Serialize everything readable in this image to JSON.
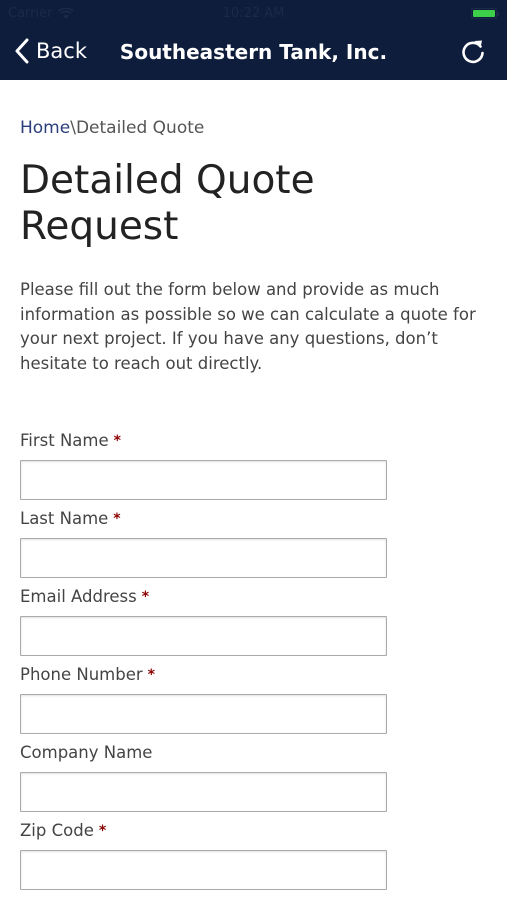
{
  "status_bar": {
    "carrier": "Carrier",
    "time": "10:22 AM"
  },
  "nav": {
    "back_label": "Back",
    "title": "Southeastern Tank, Inc.",
    "back_icon": "chevron-left-icon",
    "refresh_icon": "refresh-icon"
  },
  "breadcrumb": {
    "home": "Home",
    "separator": "\\",
    "current": "Detailed Quote"
  },
  "page": {
    "heading_line1": "Detailed Quote",
    "heading_line2": "Request",
    "intro": "Please fill out the form below and provide as much information as possible so we can calculate a quote for your next project. If you have any questions, don’t hesitate to reach out directly."
  },
  "form": {
    "first_name_label": "First Name",
    "last_name_label": "Last Name",
    "email_label": "Email Address",
    "phone_label": "Phone Number",
    "company_label": "Company Name",
    "zip_label": "Zip Code",
    "required_marker": "*"
  },
  "colors": {
    "nav_bg": "#0f1d3d",
    "required": "#8b0000",
    "link": "#2a3f7a",
    "battery": "#3ecf4a"
  }
}
